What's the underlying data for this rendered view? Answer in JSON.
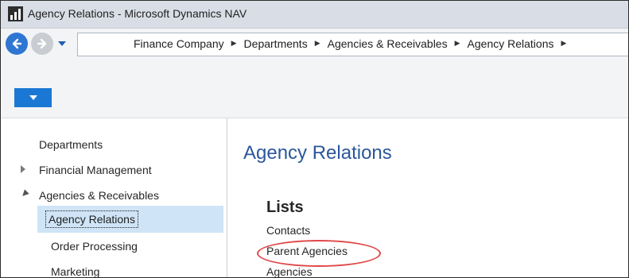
{
  "window": {
    "title": "Agency Relations - Microsoft Dynamics NAV"
  },
  "navigation": {
    "breadcrumb": [
      "Finance Company",
      "Departments",
      "Agencies & Receivables",
      "Agency Relations"
    ],
    "separator": "▶"
  },
  "icons": {
    "app": "dynamics-nav-icon",
    "back": "back-arrow-icon",
    "forward": "forward-arrow-icon",
    "history": "chevron-down-icon",
    "ribbon_menu": "chevron-down-icon"
  },
  "sidebar": {
    "items": [
      {
        "label": "Departments"
      },
      {
        "label": "Financial Management"
      },
      {
        "label": "Agencies & Receivables"
      },
      {
        "label": "Agency Relations",
        "selected": true
      },
      {
        "label": "Order Processing"
      },
      {
        "label": "Marketing"
      }
    ]
  },
  "main": {
    "title": "Agency Relations",
    "section": "Lists",
    "links": [
      "Contacts",
      "Parent Agencies",
      "Agencies"
    ]
  },
  "colors": {
    "accent": "#1a78d4",
    "title": "#2b579a",
    "selected_row": "#cfe5f7",
    "highlight": "#e04848"
  }
}
